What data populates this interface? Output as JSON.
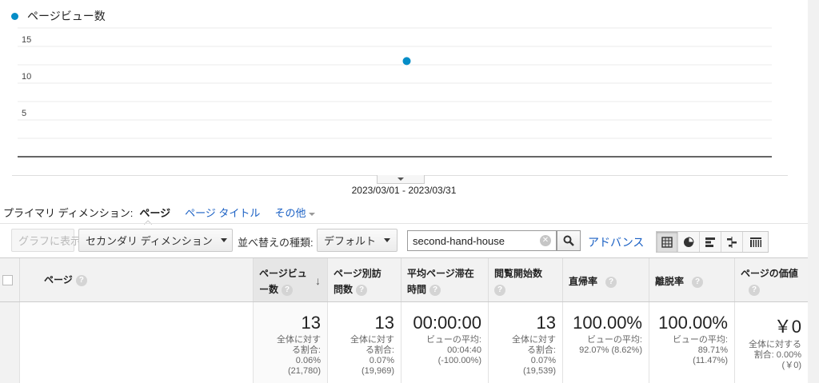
{
  "legend": {
    "label": "ページビュー数",
    "color": "#058dc7"
  },
  "chart_data": {
    "type": "scatter",
    "series": [
      {
        "name": "ページビュー数",
        "values": [
          13
        ]
      }
    ],
    "x": [
      "2023/03/01 - 2023/03/31"
    ],
    "yticks": [
      "15",
      "10",
      "5"
    ],
    "ylim": [
      0,
      15
    ],
    "grid": true,
    "color": "#058dc7",
    "x_range_label": "2023/03/01 - 2023/03/31"
  },
  "primary_dimension": {
    "label": "プライマリ ディメンション:",
    "active": "ページ",
    "options": [
      "ページ タイトル"
    ],
    "more": "その他"
  },
  "toolbar": {
    "graph_button": "グラフに表示",
    "secondary_dimension": "セカンダリ ディメンション",
    "sort_label": "並べ替えの種類:",
    "sort_value": "デフォルト",
    "search_value": "second-hand-house",
    "advanced_link": "アドバンス",
    "view_icons": [
      "table-view-icon",
      "pie-view-icon",
      "bar-view-icon",
      "comparison-view-icon",
      "pivot-view-icon"
    ]
  },
  "table": {
    "headers": {
      "page": "ページ",
      "pageviews_1": "ページビュ",
      "pageviews_2": "ー数",
      "unique_1": "ページ別訪",
      "unique_2": "問数",
      "avg_time_1": "平均ページ滞在",
      "avg_time_2": "時間",
      "entrances_1": "閲覧開始数",
      "bounce": "直帰率",
      "exit": "離脱率",
      "value_1": "ページの価値"
    },
    "totals": {
      "pageviews": {
        "value": "13",
        "s1": "全体に対す",
        "s2": "る割合:",
        "s3": "0.06%",
        "s4": "(21,780)"
      },
      "unique": {
        "value": "13",
        "s1": "全体に対す",
        "s2": "る割合:",
        "s3": "0.07%",
        "s4": "(19,969)"
      },
      "avg_time": {
        "value": "00:00:00",
        "s1": "ビューの平均:",
        "s2": "00:04:40",
        "s3": "(-100.00%)"
      },
      "entrances": {
        "value": "13",
        "s1": "全体に対す",
        "s2": "る割合:",
        "s3": "0.07%",
        "s4": "(19,539)"
      },
      "bounce": {
        "value": "100.00%",
        "s1": "ビューの平均:",
        "s2": "92.07% (8.62%)"
      },
      "exit": {
        "value": "100.00%",
        "s1": "ビューの平均:",
        "s2": "89.71%",
        "s3": "(11.47%)"
      },
      "page_value": {
        "value": "￥0",
        "s1": "全体に対する",
        "s2": "割合: 0.00%",
        "s3": "(￥0)"
      }
    }
  }
}
